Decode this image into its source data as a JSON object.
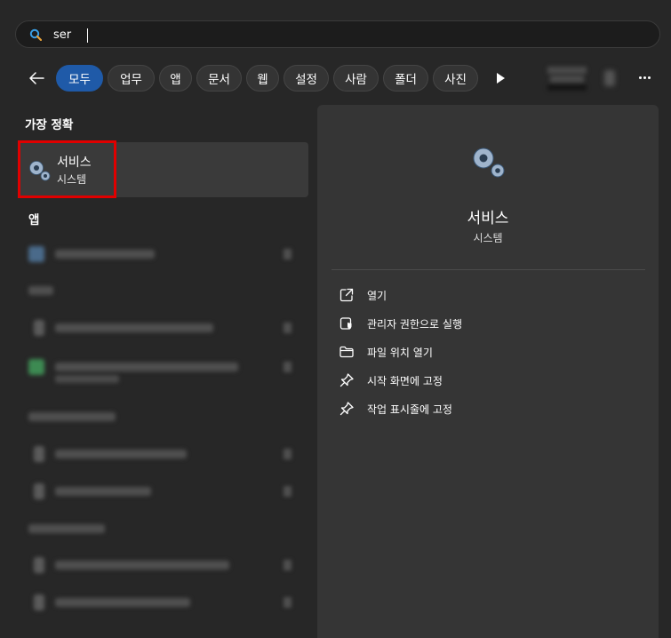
{
  "search": {
    "query": "ser"
  },
  "filters": {
    "back": "back",
    "chips": [
      "모두",
      "업무",
      "앱",
      "문서",
      "웹",
      "설정",
      "사람",
      "폴더",
      "사진"
    ],
    "active": "모두"
  },
  "left": {
    "best_match_header": "가장 정확",
    "best_match": {
      "title": "서비스",
      "subtitle": "시스템"
    },
    "apps_header": "앱"
  },
  "details": {
    "title": "서비스",
    "subtitle": "시스템",
    "actions": [
      {
        "label": "열기",
        "icon": "open-external-icon"
      },
      {
        "label": "관리자 권한으로 실행",
        "icon": "shield-admin-icon"
      },
      {
        "label": "파일 위치 열기",
        "icon": "folder-icon"
      },
      {
        "label": "시작 화면에 고정",
        "icon": "pin-icon"
      },
      {
        "label": "작업 표시줄에 고정",
        "icon": "pin-icon"
      }
    ]
  },
  "colors": {
    "accent": "#1f5aa8",
    "highlight": "#e00000",
    "background": "#272727",
    "panel": "#353535"
  }
}
